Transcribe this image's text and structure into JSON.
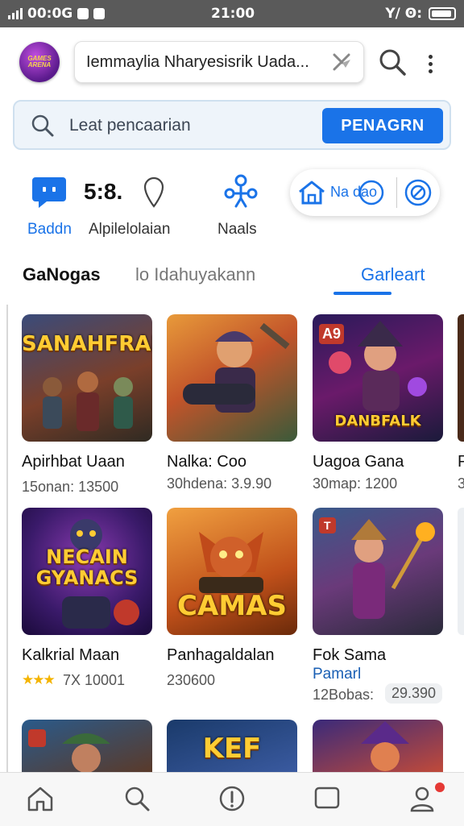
{
  "status_bar": {
    "left_text": "00:0G",
    "time": "21:00",
    "right_text": "Y/ Ꙩ:"
  },
  "header": {
    "logo_text": "GAMES ARENA",
    "title_text": "Iemmaylia Nharyesisrik Uada...",
    "icons": {
      "clear": "close-icon",
      "search": "search-icon",
      "more": "more-vert-icon"
    }
  },
  "search": {
    "placeholder": "Leat pencaarian",
    "button_label": "PENAGRN"
  },
  "categories": [
    {
      "label": "Baddn",
      "icon": "chat-icon"
    },
    {
      "label": "Alpilelolaian",
      "icon_text": "5:8.",
      "icon": "location-pin-icon"
    },
    {
      "label": "Naals",
      "icon": "network-icon"
    },
    {
      "label": "Na dao",
      "icon": "home-icon"
    }
  ],
  "tabs": [
    {
      "label": "GaNogas"
    },
    {
      "label": "lo Idahuyakann"
    },
    {
      "label": "Garleart"
    }
  ],
  "games": [
    {
      "art_title": "SANAHFRAN",
      "name": "Apirhbat Uaan",
      "meta": "15onan: 13500"
    },
    {
      "art_title": "",
      "name": "Nalka: Coo",
      "meta": "30hdena: 3.9.90"
    },
    {
      "art_title": "DANBFALK",
      "corner": "A9",
      "name": "Uagoa Gana",
      "meta": "30map: 1200"
    },
    {
      "art_title": "NECAIN GYANACS",
      "name": "Kalkrial Maan",
      "meta": "7X 10001",
      "stars": "★★★"
    },
    {
      "art_title": "CAMAS",
      "name": "Panhagaldalan",
      "meta": "230600"
    },
    {
      "art_title": "",
      "corner": "T",
      "name": "Fok Sama",
      "sub": "Pamarl",
      "meta": "12Bobas:",
      "price": "29.390"
    },
    {
      "art_title": ""
    },
    {
      "art_title": "KEF"
    },
    {
      "art_title": ""
    }
  ],
  "peek": {
    "name": "P",
    "meta": "3"
  },
  "bottom_nav": [
    {
      "icon": "home-icon"
    },
    {
      "icon": "search-icon"
    },
    {
      "icon": "info-icon"
    },
    {
      "icon": "chat-square-icon"
    },
    {
      "icon": "profile-icon"
    }
  ],
  "colors": {
    "accent": "#1a73e8",
    "status_bar": "#5a5a5a",
    "badge": "#e53935"
  }
}
